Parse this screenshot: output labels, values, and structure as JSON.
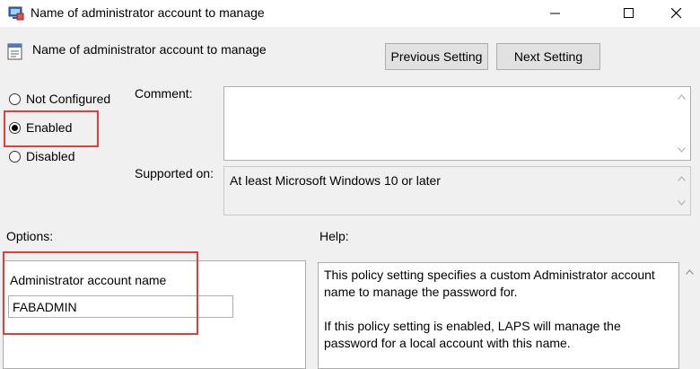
{
  "window": {
    "title": "Name of administrator account to manage",
    "icon": "policy-window-icon"
  },
  "header": {
    "policy_title": "Name of administrator account to manage",
    "previous_label": "Previous Setting",
    "next_label": "Next Setting"
  },
  "state": {
    "options": [
      {
        "label": "Not Configured",
        "selected": false
      },
      {
        "label": "Enabled",
        "selected": true
      },
      {
        "label": "Disabled",
        "selected": false
      }
    ]
  },
  "comment": {
    "label": "Comment:",
    "value": ""
  },
  "supported": {
    "label": "Supported on:",
    "value": "At least Microsoft Windows 10 or later"
  },
  "options_section": {
    "label": "Options:",
    "field_label": "Administrator account name",
    "field_value": "FABADMIN"
  },
  "help_section": {
    "label": "Help:",
    "paragraphs": [
      "This policy setting specifies a custom Administrator account name to manage the password for.",
      "If this policy setting is enabled, LAPS will manage the password for a local account with this name."
    ]
  },
  "colors": {
    "highlight": "#e0403c",
    "dialog_bg": "#f0f0f0",
    "button_bg": "#e1e1e1"
  }
}
